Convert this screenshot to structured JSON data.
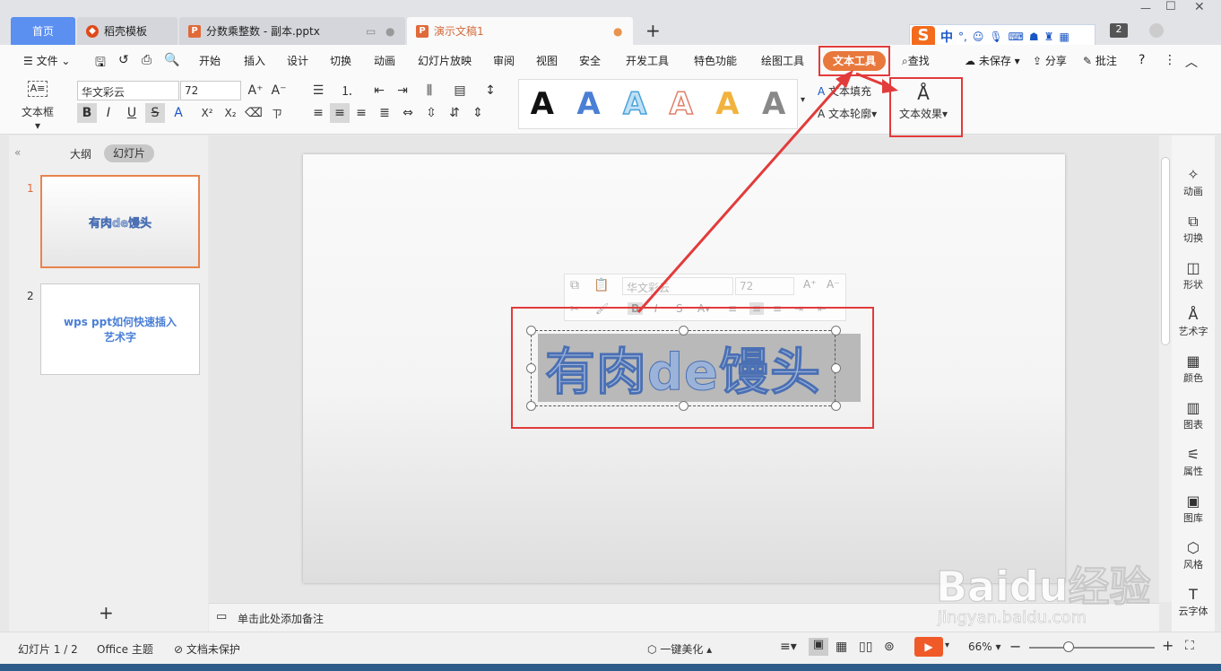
{
  "tabs": {
    "home": "首页",
    "tab2": "稻壳模板",
    "tab3": "分数乘整数 - 副本.pptx",
    "tab4": "演示文稿1",
    "add": "+",
    "badge": "2"
  },
  "ime": {
    "lang": "中",
    "punct": "°,"
  },
  "menu": {
    "file": "文件",
    "items": [
      "开始",
      "插入",
      "设计",
      "切换",
      "动画",
      "幻灯片放映",
      "审阅",
      "视图",
      "安全",
      "开发工具",
      "特色功能",
      "绘图工具"
    ],
    "active": "文本工具",
    "search": "查找",
    "unsaved": "未保存",
    "share": "分享",
    "comment": "批注"
  },
  "toolbar": {
    "textbox_label": "文本框",
    "font_name": "华文彩云",
    "font_size": "72",
    "text_fill": "文本填充",
    "text_outline": "文本轮廓",
    "text_effect": "文本效果",
    "style_letter": "A"
  },
  "panel": {
    "outline_tab": "大纲",
    "slides_tab": "幻灯片",
    "slide1_num": "1",
    "slide1_text": "有肉de馒头",
    "slide2_num": "2",
    "slide2_text": "wps ppt如何快速插入艺术字",
    "add": "+"
  },
  "mini_toolbar": {
    "font": "华文彩云",
    "size": "72"
  },
  "slide_text": "有肉de馒头",
  "notes_placeholder": "单击此处添加备注",
  "right_panel": [
    "动画",
    "切换",
    "形状",
    "艺术字",
    "颜色",
    "图表",
    "属性",
    "图库",
    "风格",
    "云字体"
  ],
  "status": {
    "slide_count": "幻灯片 1 / 2",
    "theme": "Office 主题",
    "protect": "文档未保护",
    "beautify": "一键美化",
    "zoom": "66%"
  },
  "watermark": {
    "brand": "Baidu经验",
    "url": "jingyan.baidu.com"
  }
}
